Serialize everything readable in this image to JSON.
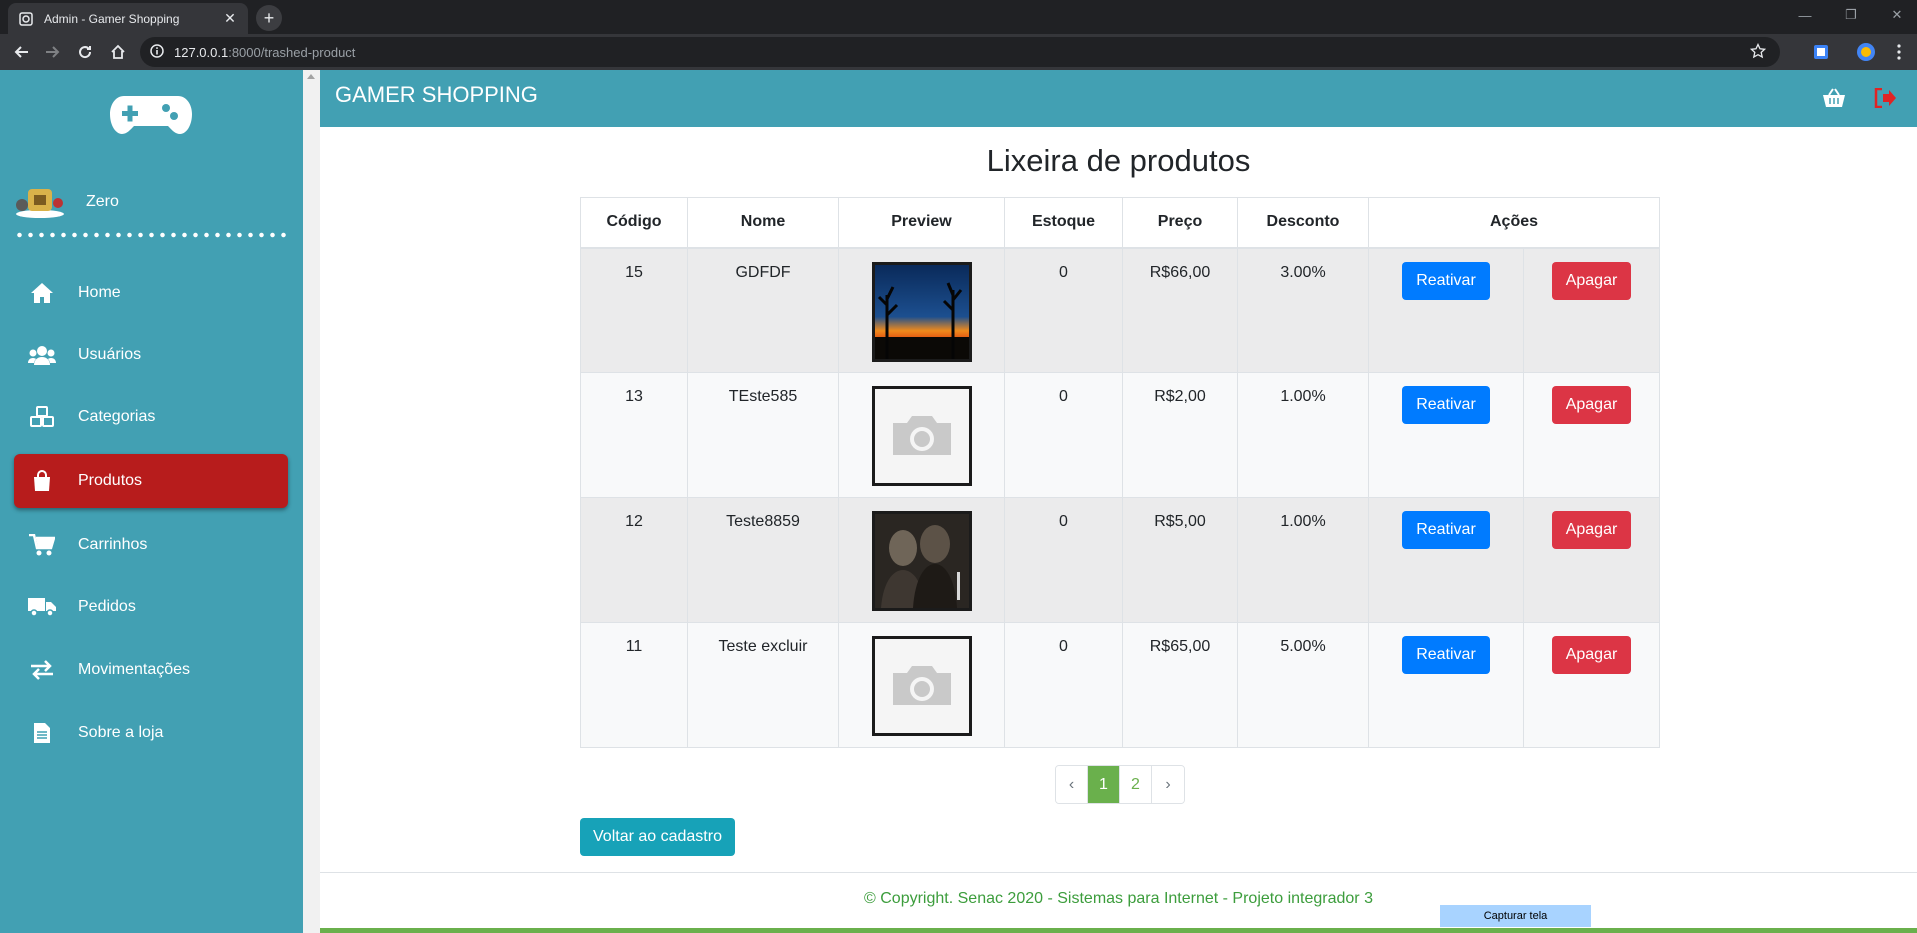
{
  "browser": {
    "tab_title": "Admin - Gamer Shopping",
    "url_host": "127.0.0.1",
    "url_path": ":8000/trashed-product",
    "new_tab_symbol": "+",
    "close_symbol": "✕"
  },
  "sidebar": {
    "user_name": "Zero",
    "items": [
      {
        "label": "Home",
        "icon": "home-icon"
      },
      {
        "label": "Usuários",
        "icon": "users-icon"
      },
      {
        "label": "Categorias",
        "icon": "cubes-icon"
      },
      {
        "label": "Produtos",
        "icon": "shopping-bag-icon"
      },
      {
        "label": "Carrinhos",
        "icon": "cart-icon"
      },
      {
        "label": "Pedidos",
        "icon": "truck-icon"
      },
      {
        "label": "Movimentações",
        "icon": "exchange-icon"
      },
      {
        "label": "Sobre a loja",
        "icon": "file-icon"
      }
    ],
    "active_item": "Produtos"
  },
  "header": {
    "brand": "GAMER SHOPPING"
  },
  "main": {
    "title": "Lixeira de produtos",
    "columns": [
      "Código",
      "Nome",
      "Preview",
      "Estoque",
      "Preço",
      "Desconto",
      "Ações"
    ],
    "rows": [
      {
        "code": "15",
        "name": "GDFDF",
        "preview": "sunset-image",
        "stock": "0",
        "price": "R$66,00",
        "discount": "3.00%",
        "reactivate": "Reativar",
        "delete": "Apagar"
      },
      {
        "code": "13",
        "name": "TEste585",
        "preview": "placeholder-camera",
        "stock": "0",
        "price": "R$2,00",
        "discount": "1.00%",
        "reactivate": "Reativar",
        "delete": "Apagar"
      },
      {
        "code": "12",
        "name": "Teste8859",
        "preview": "game-cover-image",
        "stock": "0",
        "price": "R$5,00",
        "discount": "1.00%",
        "reactivate": "Reativar",
        "delete": "Apagar"
      },
      {
        "code": "11",
        "name": "Teste excluir",
        "preview": "placeholder-camera",
        "stock": "0",
        "price": "R$65,00",
        "discount": "5.00%",
        "reactivate": "Reativar",
        "delete": "Apagar"
      }
    ],
    "pagination": {
      "prev": "‹",
      "pages": [
        "1",
        "2"
      ],
      "next": "›",
      "current": "1"
    },
    "back_button": "Voltar ao cadastro"
  },
  "footer": {
    "text": "© Copyright. Senac 2020 - Sistemas para Internet - Projeto integrador 3"
  },
  "overlay": {
    "capture_label": "Capturar tela"
  },
  "colors": {
    "sidebar": "#42a0b3",
    "active": "#b71c1c",
    "primary": "#007bff",
    "danger": "#dc3545",
    "pagination": "#6ab04c",
    "back": "#17a2b8"
  }
}
